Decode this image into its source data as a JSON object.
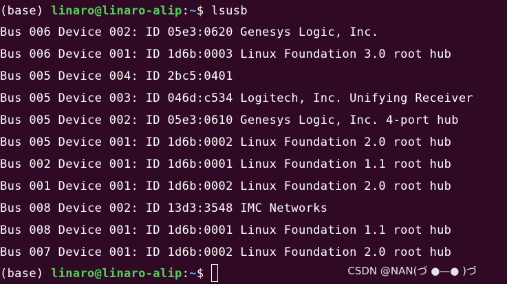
{
  "terminal": {
    "first_prompt": {
      "env": "(base) ",
      "user_host": "linaro@linaro-alip",
      "sep": ":",
      "path": "~",
      "symbol": "$ ",
      "command": "lsusb"
    },
    "output": [
      "Bus 006 Device 002: ID 05e3:0620 Genesys Logic, Inc.",
      "Bus 006 Device 001: ID 1d6b:0003 Linux Foundation 3.0 root hub",
      "Bus 005 Device 004: ID 2bc5:0401",
      "Bus 005 Device 003: ID 046d:c534 Logitech, Inc. Unifying Receiver",
      "Bus 005 Device 002: ID 05e3:0610 Genesys Logic, Inc. 4-port hub",
      "Bus 005 Device 001: ID 1d6b:0002 Linux Foundation 2.0 root hub",
      "Bus 002 Device 001: ID 1d6b:0001 Linux Foundation 1.1 root hub",
      "Bus 001 Device 001: ID 1d6b:0002 Linux Foundation 2.0 root hub",
      "Bus 008 Device 002: ID 13d3:3548 IMC Networks",
      "Bus 008 Device 001: ID 1d6b:0001 Linux Foundation 1.1 root hub",
      "Bus 007 Device 001: ID 1d6b:0002 Linux Foundation 2.0 root hub"
    ],
    "last_prompt": {
      "env": "(base) ",
      "user_host": "linaro@linaro-alip",
      "sep": ":",
      "path": "~",
      "symbol": "$ "
    }
  },
  "watermark": "CSDN @NAN(づ ●—● )づ",
  "colors": {
    "background": "#300a24",
    "text": "#ffffff",
    "user_host": "#4fd35a",
    "path": "#5fa8ff"
  }
}
